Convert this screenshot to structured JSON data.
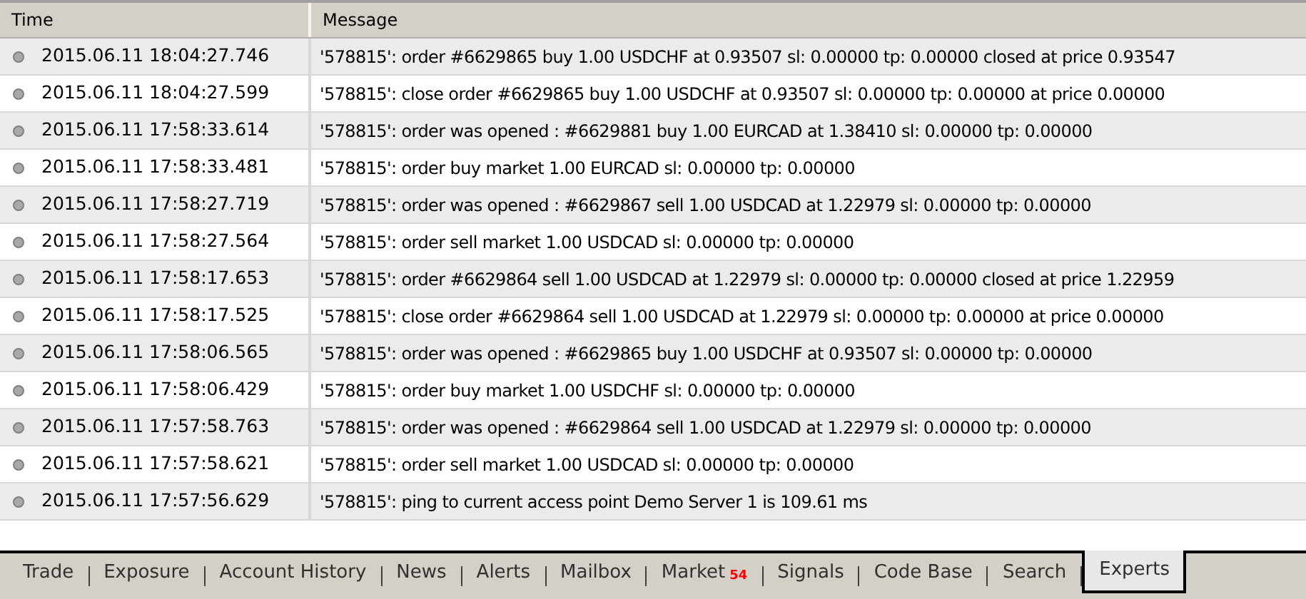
{
  "table": {
    "columns": [
      "Time",
      "Message"
    ],
    "rows": [
      {
        "time": "2015.06.11 18:04:27.746",
        "message": "'578815': order #6629865 buy 1.00 USDCHF at 0.93507 sl: 0.00000 tp: 0.00000 closed at price 0.93547"
      },
      {
        "time": "2015.06.11 18:04:27.599",
        "message": "'578815': close order #6629865 buy 1.00 USDCHF at 0.93507 sl: 0.00000 tp: 0.00000 at price 0.00000"
      },
      {
        "time": "2015.06.11 17:58:33.614",
        "message": "'578815': order was opened : #6629881 buy 1.00 EURCAD at 1.38410 sl: 0.00000 tp: 0.00000"
      },
      {
        "time": "2015.06.11 17:58:33.481",
        "message": "'578815': order buy market 1.00 EURCAD sl: 0.00000 tp: 0.00000"
      },
      {
        "time": "2015.06.11 17:58:27.719",
        "message": "'578815': order was opened : #6629867 sell 1.00 USDCAD at 1.22979 sl: 0.00000 tp: 0.00000"
      },
      {
        "time": "2015.06.11 17:58:27.564",
        "message": "'578815': order sell market 1.00 USDCAD sl: 0.00000 tp: 0.00000"
      },
      {
        "time": "2015.06.11 17:58:17.653",
        "message": "'578815': order #6629864 sell 1.00 USDCAD at 1.22979 sl: 0.00000 tp: 0.00000 closed at price 1.22959"
      },
      {
        "time": "2015.06.11 17:58:17.525",
        "message": "'578815': close order #6629864 sell 1.00 USDCAD at 1.22979 sl: 0.00000 tp: 0.00000 at price 0.00000"
      },
      {
        "time": "2015.06.11 17:58:06.565",
        "message": "'578815': order was opened : #6629865 buy 1.00 USDCHF at 0.93507 sl: 0.00000 tp: 0.00000"
      },
      {
        "time": "2015.06.11 17:58:06.429",
        "message": "'578815': order buy market 1.00 USDCHF sl: 0.00000 tp: 0.00000"
      },
      {
        "time": "2015.06.11 17:57:58.763",
        "message": "'578815': order was opened : #6629864 sell 1.00 USDCAD at 1.22979 sl: 0.00000 tp: 0.00000"
      },
      {
        "time": "2015.06.11 17:57:58.621",
        "message": "'578815': order sell market 1.00 USDCAD sl: 0.00000 tp: 0.00000"
      },
      {
        "time": "2015.06.11 17:57:56.629",
        "message": "'578815': ping to current access point Demo Server 1 is 109.61 ms"
      }
    ]
  },
  "tabs": [
    {
      "label": "Trade",
      "selected": false
    },
    {
      "label": "Exposure",
      "selected": false
    },
    {
      "label": "Account History",
      "selected": false
    },
    {
      "label": "News",
      "selected": false
    },
    {
      "label": "Alerts",
      "selected": false
    },
    {
      "label": "Mailbox",
      "selected": false
    },
    {
      "label": "Market",
      "badge": "54",
      "selected": false
    },
    {
      "label": "Signals",
      "selected": false
    },
    {
      "label": "Code Base",
      "selected": false
    },
    {
      "label": "Search",
      "selected": false
    },
    {
      "label": "Experts",
      "selected": true
    }
  ]
}
